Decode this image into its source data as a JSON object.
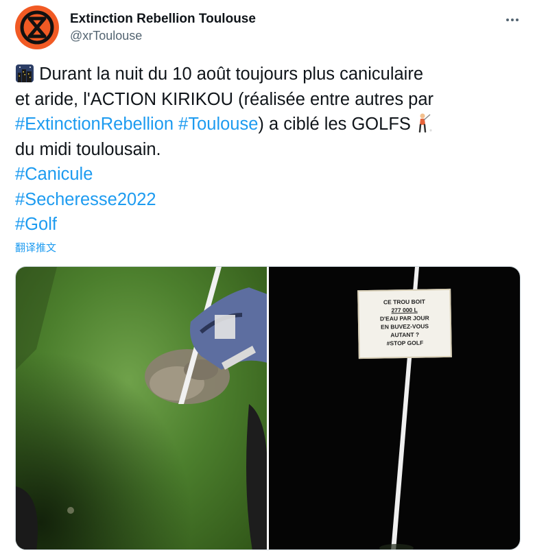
{
  "author": {
    "name": "Extinction Rebellion Toulouse",
    "handle": "@xrToulouse",
    "avatar_color": "#f15a24"
  },
  "menu": {
    "icon": "more-horizontal-icon"
  },
  "tweet": {
    "line1_text": " Durant la nuit du 10 août toujours plus caniculaire",
    "line2_text": "et aride, l'ACTION KIRIKOU (réalisée entre autres par",
    "line3_tag1": "#ExtinctionRebellion",
    "line3_tag2": "#Toulouse",
    "line3_text": ") a ciblé les GOLFS ",
    "line4_text": "du midi toulousain.",
    "hashtag1": "#Canicule",
    "hashtag2": "#Secheresse2022",
    "hashtag3": "#Golf",
    "emoji1": "night-city-emoji",
    "emoji2": "golfer-emoji"
  },
  "translate_label": "翻译推文",
  "sign": {
    "line1": "CE TROU BOIT",
    "line2": "277  000  L",
    "line3": "D'EAU PAR JOUR",
    "line4": "EN  BUVEZ-VOUS",
    "line5": "AUTANT ?",
    "line6": "#STOP  GOLF"
  },
  "colors": {
    "link": "#1d9bf0",
    "text": "#0f1419",
    "secondary": "#536471"
  }
}
